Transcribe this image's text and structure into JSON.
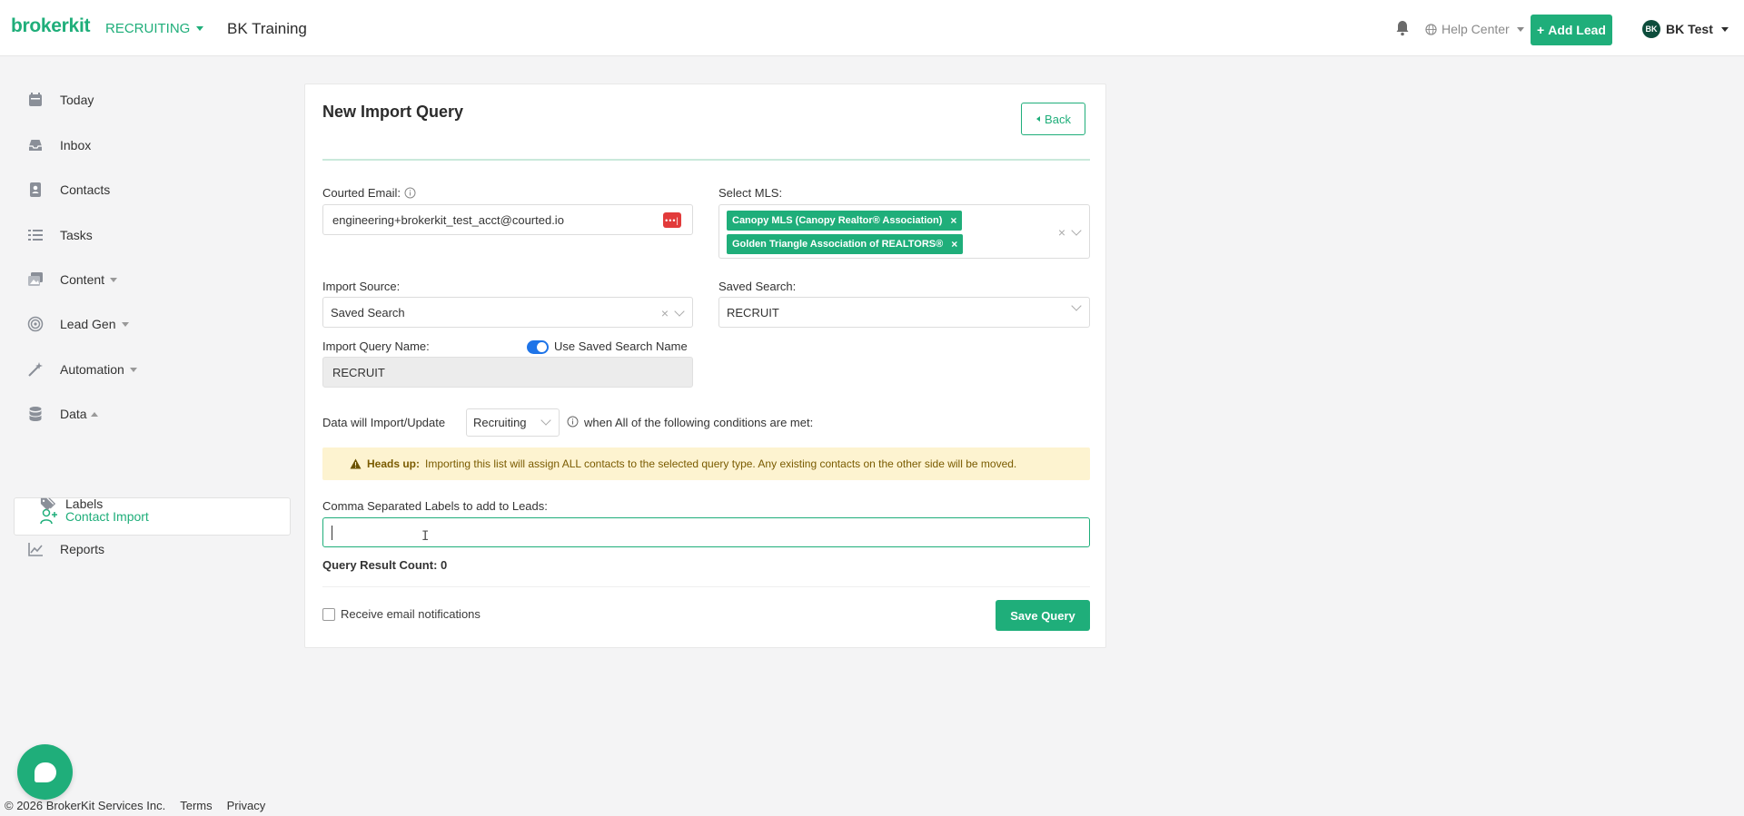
{
  "header": {
    "logo": "brokerkit",
    "module": "RECRUITING",
    "team": "BK Training",
    "help": "Help Center",
    "add_lead": "Add Lead",
    "user_initials": "BK",
    "user_name": "BK Test"
  },
  "sidebar": {
    "items": [
      {
        "label": "Today",
        "icon": "calendar-icon"
      },
      {
        "label": "Inbox",
        "icon": "inbox-icon"
      },
      {
        "label": "Contacts",
        "icon": "contact-card-icon"
      },
      {
        "label": "Tasks",
        "icon": "tasks-icon"
      },
      {
        "label": "Content",
        "icon": "content-icon"
      },
      {
        "label": "Lead Gen",
        "icon": "lead-gen-icon"
      },
      {
        "label": "Automation",
        "icon": "automation-icon"
      },
      {
        "label": "Data",
        "icon": "database-icon"
      },
      {
        "label": "Contact Import",
        "icon": "user-plus-icon"
      },
      {
        "label": "Labels",
        "icon": "tags-icon"
      },
      {
        "label": "Reports",
        "icon": "chart-icon"
      }
    ]
  },
  "form": {
    "title": "New Import Query",
    "back": "Back",
    "courted_email_label": "Courted Email:",
    "courted_email_value": "engineering+brokerkit_test_acct@courted.io",
    "select_mls_label": "Select MLS:",
    "mls_tags": [
      "Canopy MLS (Canopy Realtor® Association)",
      "Golden Triangle Association of REALTORS®"
    ],
    "import_source_label": "Import Source:",
    "import_source_value": "Saved Search",
    "saved_search_label": "Saved Search:",
    "saved_search_value": "RECRUIT",
    "query_name_label": "Import Query Name:",
    "use_saved_search_name": "Use Saved Search Name",
    "query_name_value": "RECRUIT",
    "import_update_prefix": "Data will Import/Update",
    "import_type": "Recruiting",
    "import_update_suffix": "when All of the following conditions are met:",
    "alert_heading": "Heads up:",
    "alert_text": "Importing this list will assign ALL contacts to the selected query type. Any existing contacts on the other side will be moved.",
    "labels_label": "Comma Separated Labels to add to Leads:",
    "labels_value": "",
    "result_count_label": "Query Result Count:",
    "result_count_value": "0",
    "email_notifications": "Receive email notifications",
    "save": "Save Query"
  },
  "footer": {
    "copyright": "© 2026 BrokerKit Services Inc.",
    "terms": "Terms",
    "privacy": "Privacy"
  },
  "colors": {
    "brand": "#1fae7a",
    "alert_bg": "#fdf3d0",
    "toggle": "#1e74e8"
  }
}
